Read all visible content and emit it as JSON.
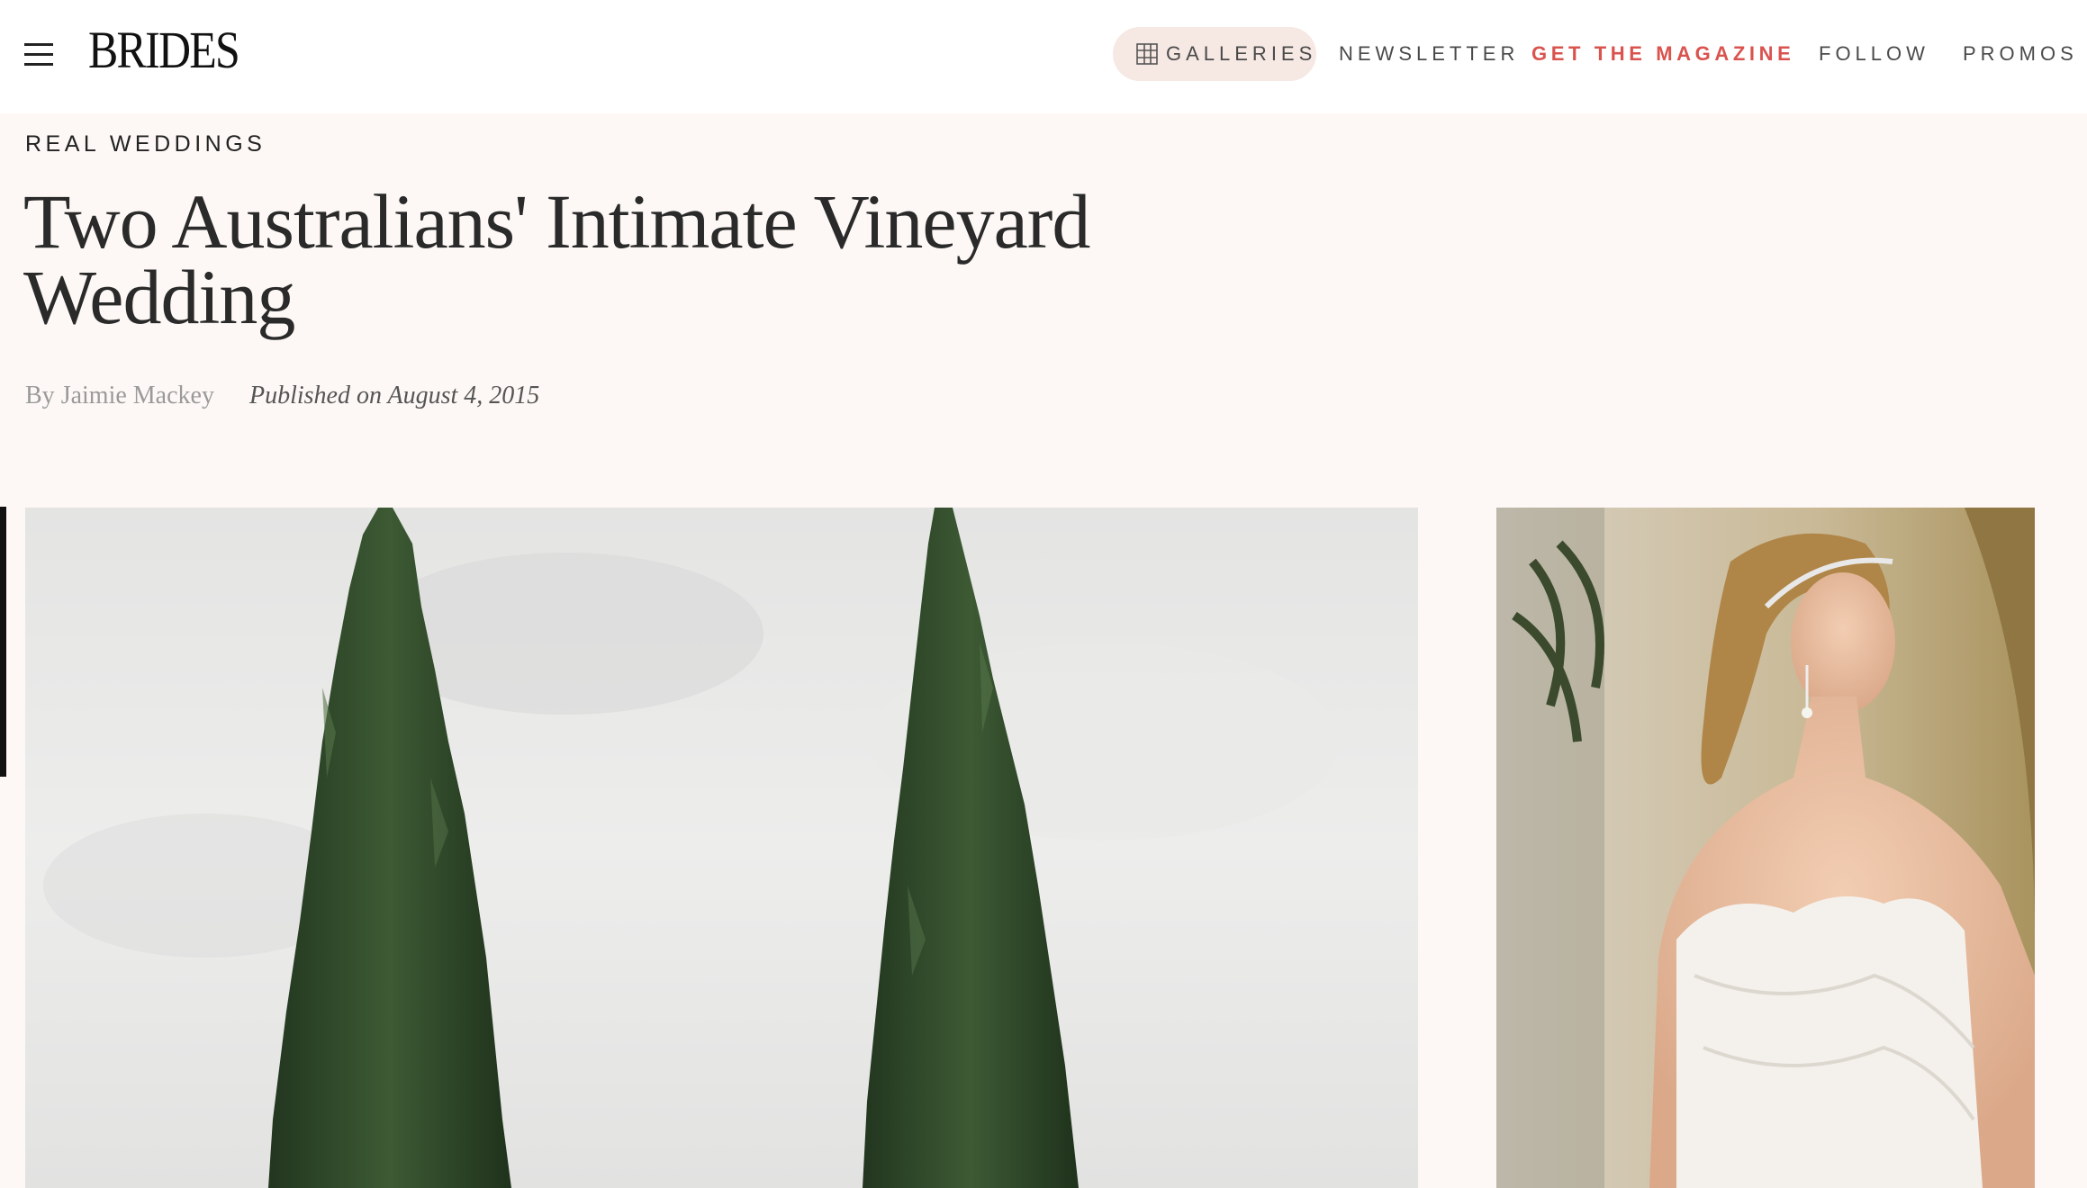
{
  "header": {
    "menu_icon": "hamburger-menu-icon",
    "logo": "BRIDES",
    "nav": {
      "galleries": "GALLERIES",
      "galleries_icon": "grid-icon",
      "newsletter": "NEWSLETTER",
      "get_magazine": "GET THE MAGAZINE",
      "follow": "FOLLOW",
      "promos": "PROMOS"
    },
    "colors": {
      "accent": "#d9534f",
      "pill_bg": "#f6e8e3"
    }
  },
  "article": {
    "category": "REAL WEDDINGS",
    "title": "Two Australians' Intimate Vineyard Wedding",
    "byline_prefix": "By",
    "author": "Jaimie Mackey",
    "published": "Published on August 4, 2015"
  },
  "page": {
    "background": "#fdf8f5"
  }
}
